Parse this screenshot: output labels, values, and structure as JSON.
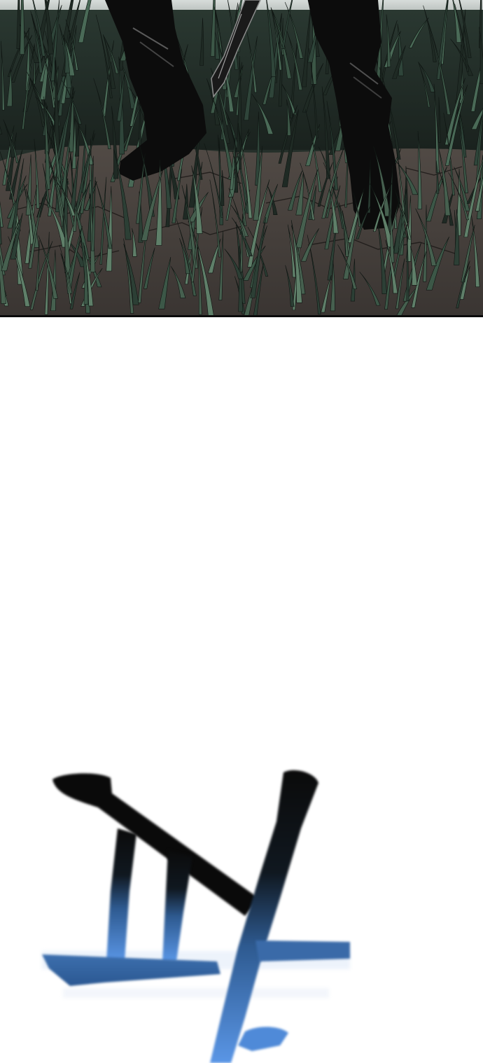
{
  "comic": {
    "panels": [
      {
        "kind": "scene",
        "subject": "boots-in-grass"
      },
      {
        "kind": "gutter"
      },
      {
        "kind": "sound-effect",
        "subject": "korean-sfx-glyph"
      }
    ],
    "colors": {
      "grass_dark": "#1f2a24",
      "grass_mid": "#3c5747",
      "grass_light": "#5f7f69",
      "dirt": "#4a4440",
      "boot": "#0c0c0c",
      "sky_strip": "#bfc5c2",
      "sfx_black": "#0a0a0a",
      "sfx_blue": "#4f8ad8",
      "page_bg": "#ffffff"
    }
  }
}
